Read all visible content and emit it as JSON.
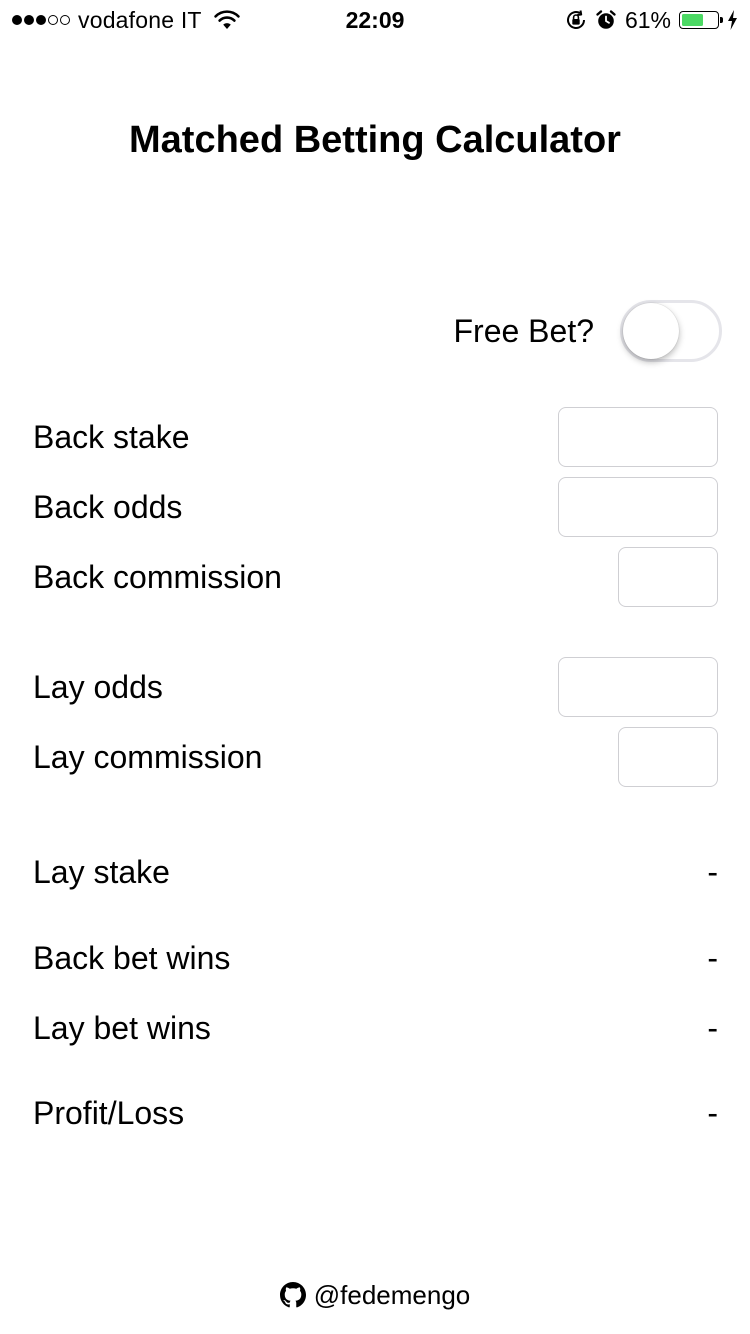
{
  "status_bar": {
    "carrier": "vodafone IT",
    "signal_bars_filled": 3,
    "signal_bars_total": 5,
    "time": "22:09",
    "battery_percent": "61%",
    "battery_level": 0.61,
    "battery_color": "#4cd964",
    "icons": [
      "wifi-icon",
      "orientation-lock-icon",
      "alarm-icon",
      "battery-icon",
      "charging-bolt-icon"
    ]
  },
  "page": {
    "title": "Matched Betting Calculator"
  },
  "free_bet": {
    "label": "Free Bet?",
    "on": false
  },
  "inputs": {
    "back_stake": {
      "label": "Back stake",
      "value": ""
    },
    "back_odds": {
      "label": "Back odds",
      "value": ""
    },
    "back_commission": {
      "label": "Back commission",
      "value": ""
    },
    "lay_odds": {
      "label": "Lay odds",
      "value": ""
    },
    "lay_commission": {
      "label": "Lay commission",
      "value": ""
    }
  },
  "results": {
    "lay_stake": {
      "label": "Lay stake",
      "value": "-"
    },
    "back_bet_wins": {
      "label": "Back bet wins",
      "value": "-"
    },
    "lay_bet_wins": {
      "label": "Lay bet wins",
      "value": "-"
    },
    "profit_loss": {
      "label": "Profit/Loss",
      "value": "-"
    }
  },
  "footer": {
    "icon": "github-icon",
    "handle": "@fedemengo"
  }
}
